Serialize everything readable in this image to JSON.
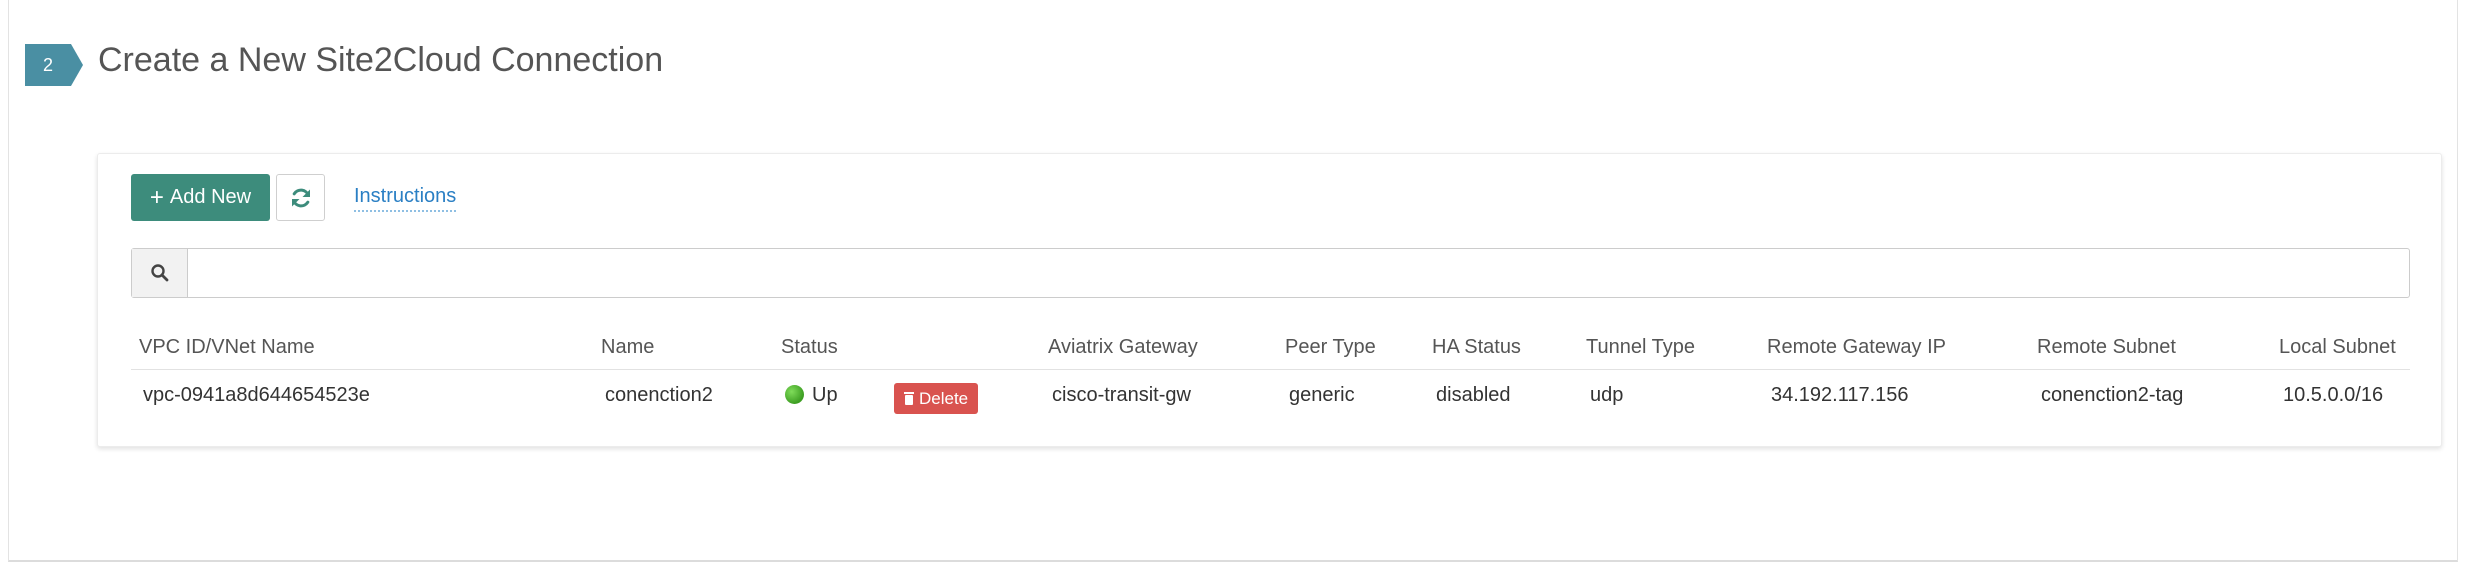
{
  "section": {
    "step_number": "2",
    "title": "Create a New Site2Cloud Connection",
    "accent_color": "#4a8fa3"
  },
  "toolbar": {
    "add_new_label": "Add New",
    "add_icon": "plus-icon",
    "refresh_icon": "refresh-icon",
    "instructions_label": "Instructions"
  },
  "search": {
    "icon": "search-icon",
    "value": "",
    "placeholder": ""
  },
  "table": {
    "columns": [
      "VPC ID/VNet Name",
      "Name",
      "Status",
      "",
      "Aviatrix Gateway",
      "Peer Type",
      "HA Status",
      "Tunnel Type",
      "Remote Gateway IP",
      "Remote Subnet",
      "Local Subnet"
    ],
    "rows": [
      {
        "vpc_id": "vpc-0941a8d644654523e",
        "name": "conenction2",
        "status": "Up",
        "status_color": "#4caf2c",
        "delete_label": "Delete",
        "gateway": "cisco-transit-gw",
        "peer_type": "generic",
        "ha_status": "disabled",
        "tunnel_type": "udp",
        "remote_gateway_ip": "34.192.117.156",
        "remote_subnet": "conenction2-tag",
        "local_subnet": "10.5.0.0/16"
      }
    ]
  },
  "colors": {
    "primary_button": "#3d8c7c",
    "delete_button": "#d9534f",
    "link": "#2a7fc4"
  }
}
